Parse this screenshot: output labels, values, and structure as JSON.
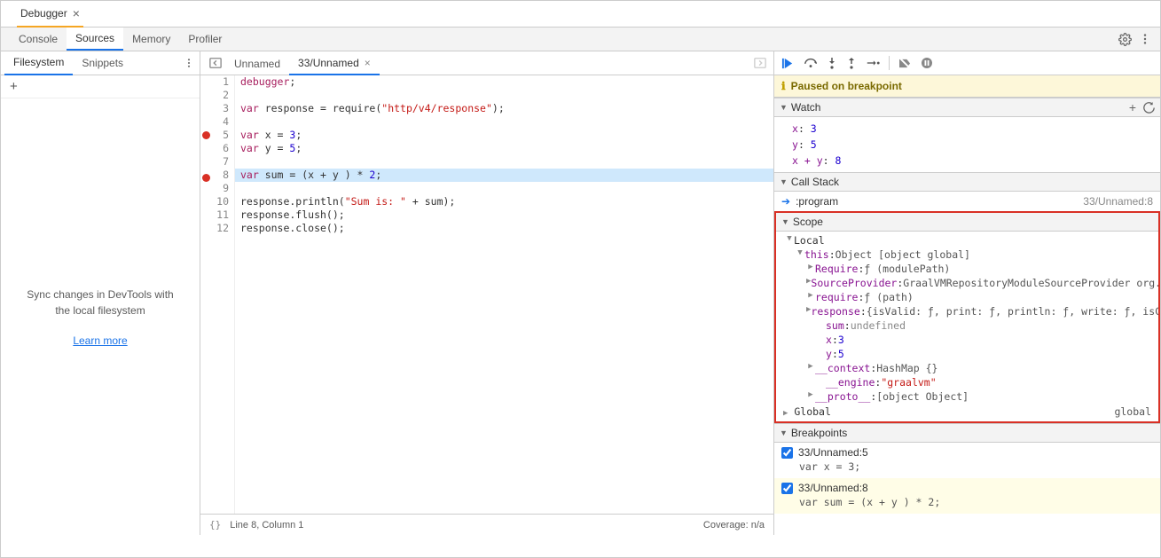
{
  "window": {
    "tab_label": "Debugger"
  },
  "panel_tabs": [
    "Console",
    "Sources",
    "Memory",
    "Profiler"
  ],
  "panel_active": "Sources",
  "left": {
    "tabs": [
      "Filesystem",
      "Snippets"
    ],
    "active": "Filesystem",
    "sync_text": "Sync changes in DevTools with the local filesystem",
    "learn_more": "Learn more"
  },
  "editor": {
    "nav_back": "◂",
    "tabs": [
      {
        "label": "Unnamed",
        "active": false,
        "closable": false
      },
      {
        "label": "33/Unnamed",
        "active": true,
        "closable": true
      }
    ],
    "lines": [
      {
        "n": 1,
        "bp": false,
        "hl": false,
        "segs": [
          [
            "kw",
            "debugger"
          ],
          [
            "p",
            ";"
          ]
        ]
      },
      {
        "n": 2,
        "bp": false,
        "hl": false,
        "segs": []
      },
      {
        "n": 3,
        "bp": false,
        "hl": false,
        "segs": [
          [
            "kw",
            "var"
          ],
          [
            "p",
            " response = require("
          ],
          [
            "str",
            "\"http/v4/response\""
          ],
          [
            "p",
            ");"
          ]
        ]
      },
      {
        "n": 4,
        "bp": false,
        "hl": false,
        "segs": []
      },
      {
        "n": 5,
        "bp": true,
        "hl": false,
        "segs": [
          [
            "kw",
            "var"
          ],
          [
            "p",
            " x = "
          ],
          [
            "num",
            "3"
          ],
          [
            "p",
            ";"
          ]
        ]
      },
      {
        "n": 6,
        "bp": false,
        "hl": false,
        "segs": [
          [
            "kw",
            "var"
          ],
          [
            "p",
            " y = "
          ],
          [
            "num",
            "5"
          ],
          [
            "p",
            ";"
          ]
        ]
      },
      {
        "n": 7,
        "bp": false,
        "hl": false,
        "segs": []
      },
      {
        "n": 8,
        "bp": true,
        "hl": true,
        "segs": [
          [
            "kw",
            "var"
          ],
          [
            "p",
            " sum = (x + y ) * "
          ],
          [
            "num",
            "2"
          ],
          [
            "p",
            ";"
          ]
        ]
      },
      {
        "n": 9,
        "bp": false,
        "hl": false,
        "segs": []
      },
      {
        "n": 10,
        "bp": false,
        "hl": false,
        "segs": [
          [
            "p",
            "response.println("
          ],
          [
            "str",
            "\"Sum is: \""
          ],
          [
            "p",
            " + sum);"
          ]
        ]
      },
      {
        "n": 11,
        "bp": false,
        "hl": false,
        "segs": [
          [
            "p",
            "response.flush();"
          ]
        ]
      },
      {
        "n": 12,
        "bp": false,
        "hl": false,
        "segs": [
          [
            "p",
            "response.close();"
          ]
        ]
      }
    ],
    "status_left": "Line 8, Column 1",
    "status_right": "Coverage: n/a"
  },
  "debugger": {
    "paused_msg": "Paused on breakpoint",
    "watch": {
      "title": "Watch",
      "items": [
        {
          "name": "x",
          "value": "3"
        },
        {
          "name": "y",
          "value": "5"
        },
        {
          "name": "x + y",
          "value": "8"
        }
      ]
    },
    "callstack": {
      "title": "Call Stack",
      "frame": ":program",
      "location": "33/Unnamed:8"
    },
    "scope": {
      "title": "Scope",
      "local_label": "Local",
      "this_label": "this",
      "this_desc": "Object [object global]",
      "props": [
        {
          "arrow": true,
          "key": "Require",
          "desc": "ƒ (modulePath)",
          "type": "desc"
        },
        {
          "arrow": true,
          "key": "SourceProvider",
          "desc": "GraalVMRepositoryModuleSourceProvider org.ecl…",
          "type": "desc"
        },
        {
          "arrow": true,
          "key": "require",
          "desc": "ƒ (path)",
          "type": "desc"
        },
        {
          "arrow": true,
          "key": "response",
          "desc": "{isValid: ƒ, print: ƒ, println: ƒ, write: ƒ, isComm…",
          "type": "desc"
        },
        {
          "arrow": false,
          "key": "sum",
          "desc": "undefined",
          "type": "undef"
        },
        {
          "arrow": false,
          "key": "x",
          "desc": "3",
          "type": "num"
        },
        {
          "arrow": false,
          "key": "y",
          "desc": "5",
          "type": "num"
        },
        {
          "arrow": true,
          "key": "__context",
          "desc": "HashMap {}",
          "type": "desc"
        },
        {
          "arrow": false,
          "key": "__engine",
          "desc": "\"graalvm\"",
          "type": "str"
        },
        {
          "arrow": true,
          "key": "__proto__",
          "desc": "[object Object]",
          "type": "desc"
        }
      ],
      "global_label": "Global",
      "global_val": "global"
    },
    "breakpoints": {
      "title": "Breakpoints",
      "items": [
        {
          "label": "33/Unnamed:5",
          "code": "var x = 3;",
          "hl": false
        },
        {
          "label": "33/Unnamed:8",
          "code": "var sum = (x + y ) * 2;",
          "hl": true
        }
      ]
    }
  }
}
